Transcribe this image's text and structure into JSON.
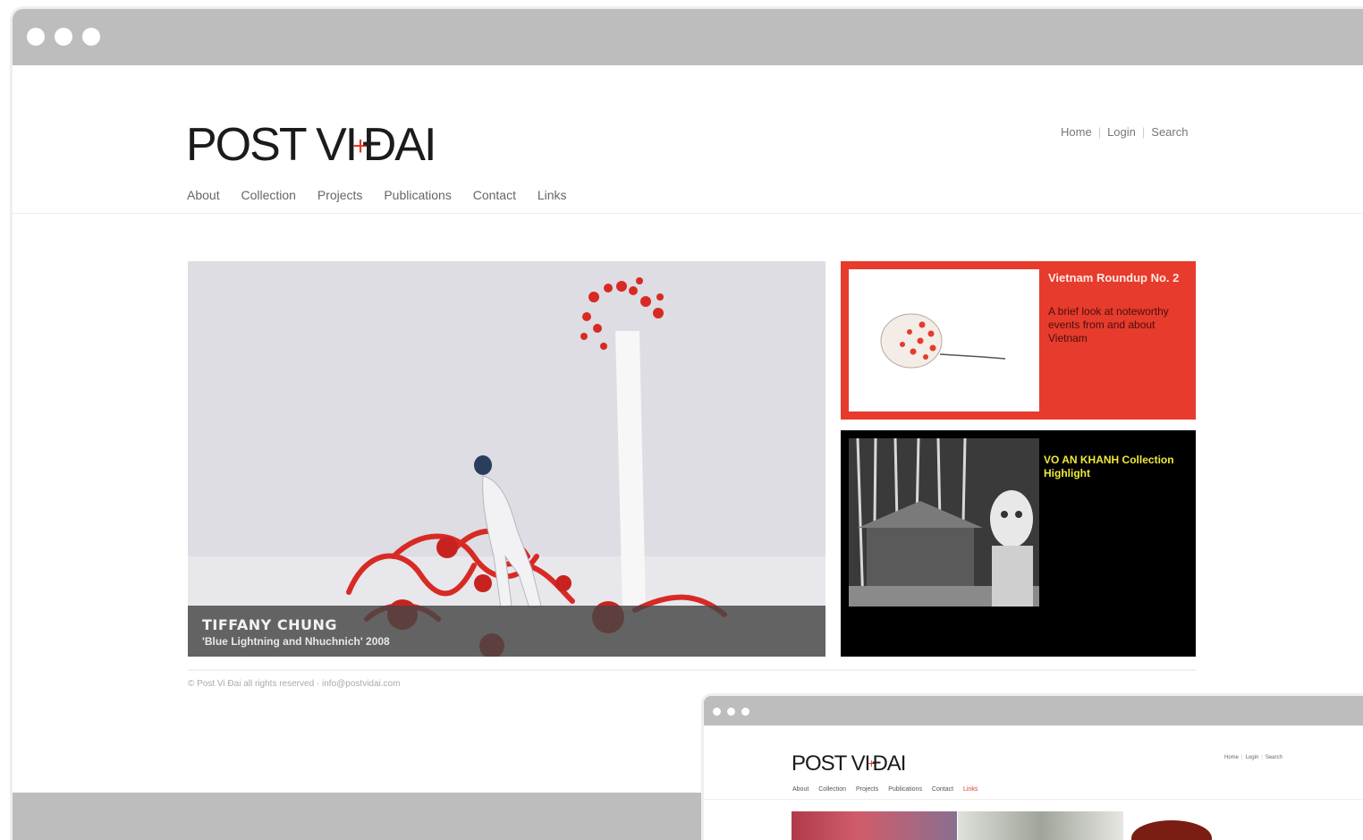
{
  "site": {
    "logo_left": "POST VI",
    "logo_mark": "+",
    "logo_right": "ĐAI"
  },
  "utility_nav": [
    "Home",
    "Login",
    "Search"
  ],
  "main_nav": [
    "About",
    "Collection",
    "Projects",
    "Publications",
    "Contact",
    "Links"
  ],
  "hero": {
    "artist": "TIFFANY CHUNG",
    "work": "'Blue Lightning and Nhuchnich' 2008"
  },
  "cards": {
    "red": {
      "title": "Vietnam Roundup No. 2",
      "description": "A brief look at noteworthy events from and about Vietnam"
    },
    "black": {
      "title": "VO AN KHANH Collection Highlight"
    }
  },
  "footer": "© Post Vi Đai all rights reserved · info@postvidai.com",
  "mini_window": {
    "logo_left": "POST VI",
    "logo_mark": "+",
    "logo_right": "ĐAI",
    "utility_nav": [
      "Home",
      "Login",
      "Search"
    ],
    "main_nav": [
      "About",
      "Collection",
      "Projects",
      "Publications",
      "Contact",
      "Links"
    ],
    "active_nav": "Links"
  },
  "colors": {
    "accent_red": "#e63b2d",
    "highlight_yellow": "#f0e83a",
    "window_chrome": "#bdbdbd"
  }
}
